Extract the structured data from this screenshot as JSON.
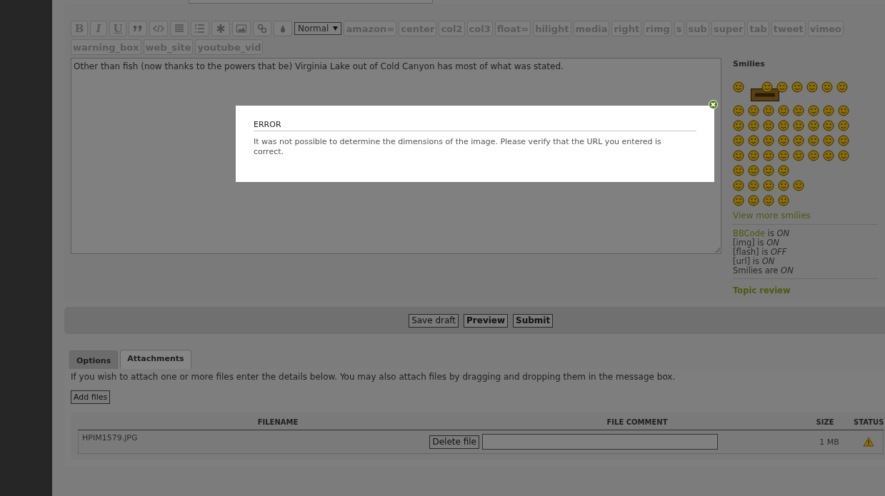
{
  "toolbar": {
    "format_buttons": [
      "B",
      "I",
      "U"
    ],
    "size_select": "Normal",
    "bbcode_buttons": [
      "amazon=",
      "center",
      "col2",
      "col3",
      "float=",
      "hilight",
      "media",
      "right",
      "rimg",
      "s",
      "sub",
      "super",
      "tab",
      "tweet",
      "vimeo",
      "warning_box",
      "web_site",
      "youtube_vid"
    ]
  },
  "editor": {
    "value": "Other than fish (now thanks to the powers that be) Virginia Lake out of Cold Canyon has most of what was stated."
  },
  "smilies": {
    "title": "Smilies",
    "view_more": "View more smilies",
    "status_lines": [
      {
        "link": "BBCode",
        "text": "is *ON*"
      },
      {
        "text": "[img] is *ON*"
      },
      {
        "text": "[flash] is *OFF*"
      },
      {
        "text": "[url] is *ON*"
      },
      {
        "text": "Smilies are *ON*"
      }
    ],
    "topic_review": "Topic review"
  },
  "dialog": {
    "title": "ERROR",
    "message": "It was not possible to determine the dimensions of the image. Please verify that the URL you entered is correct."
  },
  "actions": [
    {
      "label": "Save draft",
      "primary": false
    },
    {
      "label": "Preview",
      "primary": true
    },
    {
      "label": "Submit",
      "primary": true
    }
  ],
  "tabs": [
    {
      "label": "Options",
      "selected": false
    },
    {
      "label": "Attachments",
      "selected": true
    }
  ],
  "attach_hint": "If you wish to attach one or more files enter the details below. You may also attach files by dragging and dropping them in the message box.",
  "add_files": "Add files",
  "attachments": {
    "columns": [
      "FILENAME",
      "FILE COMMENT",
      "SIZE",
      "STATUS"
    ],
    "rows": [
      {
        "filename": "HPIM1579.JPG",
        "delete": "Delete file",
        "size": "1 MB",
        "kind": "warning"
      }
    ]
  }
}
